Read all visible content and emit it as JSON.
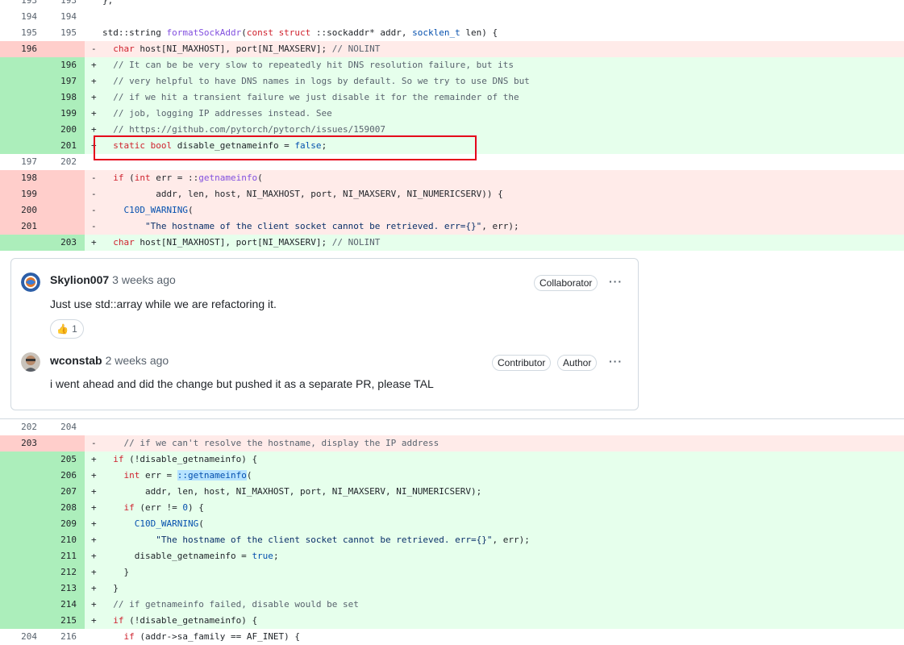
{
  "diff_top": [
    {
      "type": "ctx",
      "old": "193",
      "new": "193",
      "marker": "",
      "code": [
        [
          "};",
          ""
        ]
      ]
    },
    {
      "type": "ctx",
      "old": "194",
      "new": "194",
      "marker": "",
      "code": []
    },
    {
      "type": "ctx",
      "old": "195",
      "new": "195",
      "marker": "",
      "code": [
        [
          "std::string ",
          ""
        ],
        [
          "formatSockAddr",
          "fn"
        ],
        [
          "(",
          ""
        ],
        [
          "const struct",
          "kw"
        ],
        [
          " ::sockaddr* addr, ",
          ""
        ],
        [
          "socklen_t",
          "ty"
        ],
        [
          " len) {",
          ""
        ]
      ]
    },
    {
      "type": "del",
      "old": "196",
      "new": "",
      "marker": "-",
      "code": [
        [
          "  ",
          ""
        ],
        [
          "char",
          "kw"
        ],
        [
          " host[NI_MAXHOST], port[NI_MAXSERV]; ",
          ""
        ],
        [
          "// NOLINT",
          "cm"
        ]
      ]
    },
    {
      "type": "add",
      "old": "",
      "new": "196",
      "marker": "+",
      "code": [
        [
          "  ",
          ""
        ],
        [
          "// It can be be very slow to repeatedly hit DNS resolution failure, but its",
          "cm"
        ]
      ]
    },
    {
      "type": "add",
      "old": "",
      "new": "197",
      "marker": "+",
      "code": [
        [
          "  ",
          ""
        ],
        [
          "// very helpful to have DNS names in logs by default. So we try to use DNS but",
          "cm"
        ]
      ]
    },
    {
      "type": "add",
      "old": "",
      "new": "198",
      "marker": "+",
      "code": [
        [
          "  ",
          ""
        ],
        [
          "// if we hit a transient failure we just disable it for the remainder of the",
          "cm"
        ]
      ]
    },
    {
      "type": "add",
      "old": "",
      "new": "199",
      "marker": "+",
      "code": [
        [
          "  ",
          ""
        ],
        [
          "// job, logging IP addresses instead. See",
          "cm"
        ]
      ]
    },
    {
      "type": "add",
      "old": "",
      "new": "200",
      "marker": "+",
      "code": [
        [
          "  ",
          ""
        ],
        [
          "// https://github.com/pytorch/pytorch/issues/159007",
          "cm"
        ]
      ]
    },
    {
      "type": "add",
      "old": "",
      "new": "201",
      "marker": "+",
      "code": [
        [
          "  ",
          ""
        ],
        [
          "static bool",
          "kw"
        ],
        [
          " disable_getnameinfo = ",
          ""
        ],
        [
          "false",
          "ty"
        ],
        [
          ";",
          ""
        ]
      ]
    },
    {
      "type": "ctx",
      "old": "197",
      "new": "202",
      "marker": "",
      "code": []
    },
    {
      "type": "del",
      "old": "198",
      "new": "",
      "marker": "-",
      "code": [
        [
          "  ",
          ""
        ],
        [
          "if",
          "kw"
        ],
        [
          " (",
          ""
        ],
        [
          "int",
          "kw"
        ],
        [
          " err = ::",
          ""
        ],
        [
          "getnameinfo",
          "fn"
        ],
        [
          "(",
          ""
        ]
      ]
    },
    {
      "type": "del",
      "old": "199",
      "new": "",
      "marker": "-",
      "code": [
        [
          "          addr, len, host, NI_MAXHOST, port, NI_MAXSERV, NI_NUMERICSERV)) {",
          ""
        ]
      ]
    },
    {
      "type": "del",
      "old": "200",
      "new": "",
      "marker": "-",
      "code": [
        [
          "    ",
          ""
        ],
        [
          "C10D_WARNING",
          "mc"
        ],
        [
          "(",
          ""
        ]
      ]
    },
    {
      "type": "del",
      "old": "201",
      "new": "",
      "marker": "-",
      "code": [
        [
          "        ",
          ""
        ],
        [
          "\"The hostname of the client socket cannot be retrieved. err={}\"",
          "st"
        ],
        [
          ", err);",
          ""
        ]
      ]
    },
    {
      "type": "add",
      "old": "",
      "new": "203",
      "marker": "+",
      "code": [
        [
          "  ",
          ""
        ],
        [
          "char",
          "kw"
        ],
        [
          " host[NI_MAXHOST], port[NI_MAXSERV]; ",
          ""
        ],
        [
          "// NOLINT",
          "cm"
        ]
      ]
    }
  ],
  "thread": {
    "comments": [
      {
        "author": "Skylion007",
        "time": "3 weeks ago",
        "badges": [
          "Collaborator"
        ],
        "body": "Just use std::array while we are refactoring it.",
        "reaction_emoji": "👍",
        "reaction_count": "1"
      },
      {
        "author": "wconstab",
        "time": "2 weeks ago",
        "badges": [
          "Contributor",
          "Author"
        ],
        "body": "i went ahead and did the change but pushed it as a separate PR, please TAL"
      }
    ],
    "menu_glyph": "···"
  },
  "diff_bottom": [
    {
      "type": "ctx",
      "old": "202",
      "new": "204",
      "marker": "",
      "code": []
    },
    {
      "type": "del",
      "old": "203",
      "new": "",
      "marker": "-",
      "code": [
        [
          "    ",
          ""
        ],
        [
          "// if we can't resolve the hostname, display the IP address",
          "cm"
        ]
      ]
    },
    {
      "type": "add",
      "old": "",
      "new": "205",
      "marker": "+",
      "code": [
        [
          "  ",
          ""
        ],
        [
          "if",
          "kw"
        ],
        [
          " (!disable_getnameinfo) {",
          ""
        ]
      ]
    },
    {
      "type": "add",
      "old": "",
      "new": "206",
      "marker": "+",
      "code": [
        [
          "    ",
          ""
        ],
        [
          "int",
          "kw"
        ],
        [
          " err = ",
          ""
        ],
        [
          "::getnameinfo",
          "hl"
        ],
        [
          "(",
          ""
        ]
      ]
    },
    {
      "type": "add",
      "old": "",
      "new": "207",
      "marker": "+",
      "code": [
        [
          "        addr, len, host, NI_MAXHOST, port, NI_MAXSERV, NI_NUMERICSERV);",
          ""
        ]
      ]
    },
    {
      "type": "add",
      "old": "",
      "new": "208",
      "marker": "+",
      "code": [
        [
          "    ",
          ""
        ],
        [
          "if",
          "kw"
        ],
        [
          " (err != ",
          ""
        ],
        [
          "0",
          "ty"
        ],
        [
          ") {",
          ""
        ]
      ]
    },
    {
      "type": "add",
      "old": "",
      "new": "209",
      "marker": "+",
      "code": [
        [
          "      ",
          ""
        ],
        [
          "C10D_WARNING",
          "mc"
        ],
        [
          "(",
          ""
        ]
      ]
    },
    {
      "type": "add",
      "old": "",
      "new": "210",
      "marker": "+",
      "code": [
        [
          "          ",
          ""
        ],
        [
          "\"The hostname of the client socket cannot be retrieved. err={}\"",
          "st"
        ],
        [
          ", err);",
          ""
        ]
      ]
    },
    {
      "type": "add",
      "old": "",
      "new": "211",
      "marker": "+",
      "code": [
        [
          "      disable_getnameinfo = ",
          ""
        ],
        [
          "true",
          "ty"
        ],
        [
          ";",
          ""
        ]
      ]
    },
    {
      "type": "add",
      "old": "",
      "new": "212",
      "marker": "+",
      "code": [
        [
          "    }",
          ""
        ]
      ]
    },
    {
      "type": "add",
      "old": "",
      "new": "213",
      "marker": "+",
      "code": [
        [
          "  }",
          ""
        ]
      ]
    },
    {
      "type": "add",
      "old": "",
      "new": "214",
      "marker": "+",
      "code": [
        [
          "  ",
          ""
        ],
        [
          "// if getnameinfo failed, disable would be set",
          "cm"
        ]
      ]
    },
    {
      "type": "add",
      "old": "",
      "new": "215",
      "marker": "+",
      "code": [
        [
          "  ",
          ""
        ],
        [
          "if",
          "kw"
        ],
        [
          " (!disable_getnameinfo) {",
          ""
        ]
      ]
    },
    {
      "type": "ctx",
      "old": "204",
      "new": "216",
      "marker": "",
      "code": [
        [
          "    ",
          ""
        ],
        [
          "if",
          "kw"
        ],
        [
          " (addr->sa_family == AF_INET) {",
          ""
        ]
      ]
    }
  ]
}
